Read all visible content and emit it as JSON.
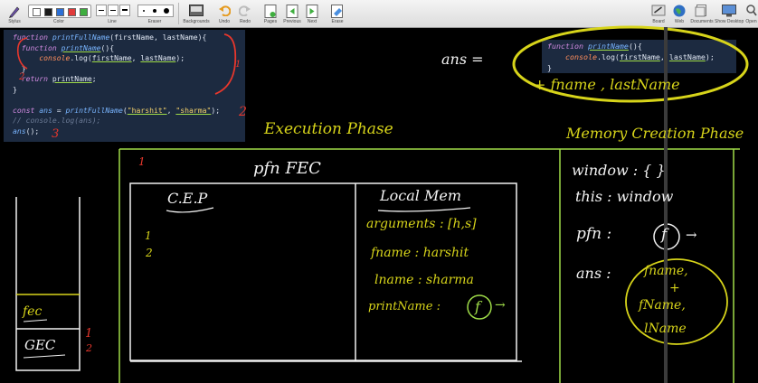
{
  "toolbar": {
    "stylus": "Stylus",
    "color": "Color",
    "line": "Line",
    "eraser": "Eraser",
    "backgrounds": "Backgrounds",
    "undo": "Undo",
    "redo": "Redo",
    "pages": "Pages",
    "previous": "Previous",
    "next": "Next",
    "erase": "Erase",
    "board": "Board",
    "web": "Web",
    "documents": "Documents",
    "show_desktop": "Show Desktop",
    "open": "Open",
    "colors": [
      "#1a1a1a",
      "#2b6fd6",
      "#e03a3a",
      "#3fae3f",
      "#f2d21c"
    ]
  },
  "code": {
    "line1": {
      "kw": "function",
      "name": "printFullName",
      "params": "(firstName, lastName){"
    },
    "line2": {
      "kw": "function",
      "name": "printName",
      "rest": "(){"
    },
    "line3": {
      "obj": "console",
      "method": ".log(",
      "a1": "firstName",
      "sep": ", ",
      "a2": "lastName",
      "end": ");"
    },
    "line4": "}",
    "line5": {
      "kw": "return",
      "name": "printName",
      "end": ";"
    },
    "line6": "}",
    "line7": {
      "kw": "const",
      "var": "ans",
      "eq": " = ",
      "call": "printFullName",
      "open": "(",
      "s1": "\"harshit\"",
      "comma": ", ",
      "s2": "\"sharma\"",
      "close": ");"
    },
    "line8": "// console.log(ans);",
    "line9": {
      "call": "ans",
      "rest": "();"
    }
  },
  "snippet": {
    "line1": {
      "kw": "function",
      "name": "printName",
      "rest": "(){"
    },
    "line2": {
      "obj": "console",
      "method": ".log(",
      "a1": "firstName",
      "sep": ", ",
      "a2": "lastName",
      "end": ");"
    },
    "line3": "}"
  },
  "handwriting": {
    "execution_phase": "Execution Phase",
    "memory_creation_phase": "Memory Creation Phase",
    "ans_eq": "ans =",
    "closure_note": "+ fname , lastName",
    "tick_1": "1",
    "pfn_fec": "pfn   FEC",
    "cep": "C.E.P",
    "cep_1": "1",
    "cep_2": "2",
    "local_mem": "Local Mem",
    "arguments": "arguments : [h,s]",
    "fname": "fname : harshit",
    "lname": "lname : sharma",
    "printname": "printName :",
    "f_symbol": "f",
    "arrow": "→",
    "window": "window : {  }",
    "this": "this : window",
    "pfn": "pfn :",
    "ans": "ans :",
    "ans_value_l1": "fname,",
    "ans_value_plus": "+",
    "ans_value_l2": "fName,",
    "ans_value_l3": "lName",
    "stack_fec": "fec",
    "stack_gec": "GEC",
    "stack_1": "1",
    "stack_2": "2",
    "code_mark_2": "2",
    "code_mark_3": "3",
    "code_mark_1": "1",
    "code_mark_line5": "2"
  }
}
